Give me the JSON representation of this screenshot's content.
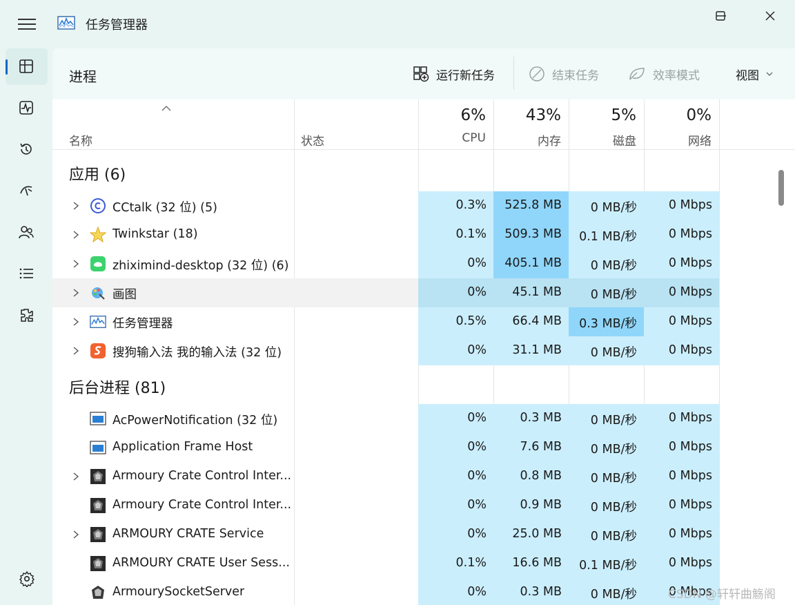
{
  "window": {
    "title": "任务管理器",
    "controls": [
      "minimize-icon",
      "maximize-icon",
      "close-icon"
    ]
  },
  "sidebar": {
    "items": [
      {
        "name": "processes",
        "icon": "processes-icon",
        "active": true
      },
      {
        "name": "performance",
        "icon": "performance-icon"
      },
      {
        "name": "app-history",
        "icon": "history-icon"
      },
      {
        "name": "startup",
        "icon": "startup-icon"
      },
      {
        "name": "users",
        "icon": "users-icon"
      },
      {
        "name": "details",
        "icon": "details-icon"
      },
      {
        "name": "services",
        "icon": "services-icon"
      }
    ],
    "settings_icon": "gear-icon"
  },
  "toolbar": {
    "page_title": "进程",
    "run_new_task": "运行新任务",
    "end_task": "结束任务",
    "efficiency_mode": "效率模式",
    "view": "视图"
  },
  "columns": {
    "name": "名称",
    "status": "状态",
    "cpu": {
      "pct": "6%",
      "label": "CPU"
    },
    "memory": {
      "pct": "43%",
      "label": "内存"
    },
    "disk": {
      "pct": "5%",
      "label": "磁盘"
    },
    "network": {
      "pct": "0%",
      "label": "网络"
    }
  },
  "sections": {
    "apps": "应用 (6)",
    "background": "后台进程 (81)"
  },
  "apps": [
    {
      "name": "CCtalk (32 位) (5)",
      "cpu": "0.3%",
      "mem": "525.8 MB",
      "disk": "0 MB/秒",
      "net": "0 Mbps",
      "icon": "cctalk-icon",
      "expand": true
    },
    {
      "name": "Twinkstar (18)",
      "cpu": "0.1%",
      "mem": "509.3 MB",
      "disk": "0.1 MB/秒",
      "net": "0 Mbps",
      "icon": "twinkstar-icon",
      "expand": true
    },
    {
      "name": "zhiximind-desktop (32 位) (6)",
      "cpu": "0%",
      "mem": "405.1 MB",
      "disk": "0 MB/秒",
      "net": "0 Mbps",
      "icon": "zhiximind-icon",
      "expand": true
    },
    {
      "name": "画图",
      "cpu": "0%",
      "mem": "45.1 MB",
      "disk": "0 MB/秒",
      "net": "0 Mbps",
      "icon": "paint-icon",
      "expand": true
    },
    {
      "name": "任务管理器",
      "cpu": "0.5%",
      "mem": "66.4 MB",
      "disk": "0.3 MB/秒",
      "net": "0 Mbps",
      "icon": "task-manager-icon",
      "expand": true
    },
    {
      "name": "搜狗输入法 我的输入法 (32 位)",
      "cpu": "0%",
      "mem": "31.1 MB",
      "disk": "0 MB/秒",
      "net": "0 Mbps",
      "icon": "sogou-icon",
      "expand": true
    }
  ],
  "background": [
    {
      "name": "AcPowerNotification (32 位)",
      "cpu": "0%",
      "mem": "0.3 MB",
      "disk": "0 MB/秒",
      "net": "0 Mbps",
      "icon": "window-app-icon",
      "expand": false
    },
    {
      "name": "Application Frame Host",
      "cpu": "0%",
      "mem": "7.6 MB",
      "disk": "0 MB/秒",
      "net": "0 Mbps",
      "icon": "window-app-icon",
      "expand": false
    },
    {
      "name": "Armoury Crate Control Inter...",
      "cpu": "0%",
      "mem": "0.8 MB",
      "disk": "0 MB/秒",
      "net": "0 Mbps",
      "icon": "armoury-icon",
      "expand": true
    },
    {
      "name": "Armoury Crate Control Inter...",
      "cpu": "0%",
      "mem": "0.9 MB",
      "disk": "0 MB/秒",
      "net": "0 Mbps",
      "icon": "armoury-icon",
      "expand": false
    },
    {
      "name": "ARMOURY CRATE Service",
      "cpu": "0%",
      "mem": "25.0 MB",
      "disk": "0 MB/秒",
      "net": "0 Mbps",
      "icon": "armoury-icon",
      "expand": true
    },
    {
      "name": "ARMOURY CRATE User Sess...",
      "cpu": "0.1%",
      "mem": "16.6 MB",
      "disk": "0.1 MB/秒",
      "net": "0 Mbps",
      "icon": "armoury-icon",
      "expand": false
    },
    {
      "name": "ArmourySocketServer",
      "cpu": "0%",
      "mem": "0.3 MB",
      "disk": "0 MB/秒",
      "net": "0 Mbps",
      "icon": "armoury-socket-icon",
      "expand": false
    }
  ],
  "watermark": "CSDN @轩轩曲觞阁",
  "colors": {
    "accent": "#1565c0",
    "cell_light": "#cbeefc",
    "cell_mid": "#90d6fa",
    "background": "#e9f5f3"
  }
}
